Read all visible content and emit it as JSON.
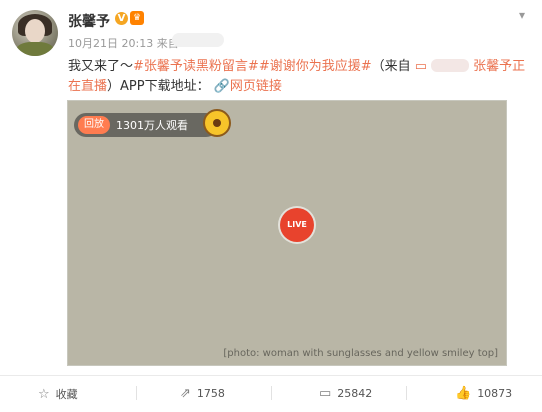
{
  "user": {
    "name": "张馨予",
    "verified_icon": "v-badge-icon",
    "vip_icon": "vip-icon"
  },
  "meta": {
    "time": "10月21日 20:13",
    "source_prefix": "来自"
  },
  "post": {
    "text_1": "我又来了～",
    "hashtag_1": "#张馨予读黑粉留言#",
    "hashtag_2": "#谢谢你为我应援#",
    "paren_open": "（来自",
    "live_name": "张馨予正在直播",
    "text_2": "）APP下载地址：",
    "link_icon": "link-icon",
    "link_text": "网页链接"
  },
  "video": {
    "replay_label": "回放",
    "viewers": "1301万人观看",
    "live_label": "LIVE",
    "placeholder": "[photo: woman with sunglasses and yellow smiley top]"
  },
  "actions": [
    {
      "icon": "star-icon",
      "label": "收藏"
    },
    {
      "icon": "share-icon",
      "label": "1758"
    },
    {
      "icon": "comment-icon",
      "label": "25842"
    },
    {
      "icon": "thumbs-up-icon",
      "label": "10873"
    }
  ]
}
